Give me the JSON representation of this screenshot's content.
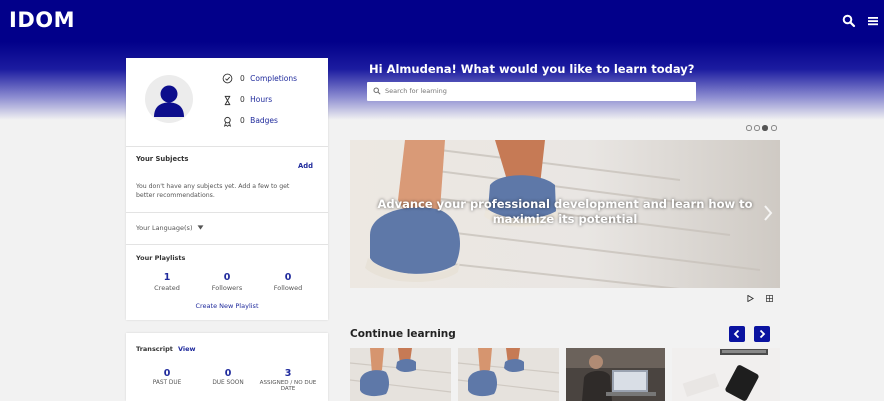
{
  "header": {
    "logo": "IDOM"
  },
  "greeting": "Hi Almudena! What would you like to learn today?",
  "search": {
    "placeholder": "Search for learning"
  },
  "profile": {
    "completions_count": "0",
    "completions_label": "Completions",
    "hours_count": "0",
    "hours_label": "Hours",
    "badges_count": "0",
    "badges_label": "Badges"
  },
  "subjects": {
    "title": "Your Subjects",
    "add_label": "Add",
    "empty_text_1": "You don't have any subjects yet. Add a few to get",
    "empty_text_2": "better recommendations."
  },
  "language": {
    "label": "Your Language(s)"
  },
  "playlists": {
    "title": "Your Playlists",
    "stats": [
      {
        "value": "1",
        "label": "Created"
      },
      {
        "value": "0",
        "label": "Followers"
      },
      {
        "value": "0",
        "label": "Followed"
      }
    ],
    "create_label": "Create New Playlist"
  },
  "transcript": {
    "title": "Transcript",
    "view_label": "View",
    "stats": [
      {
        "value": "0",
        "label": "PAST DUE"
      },
      {
        "value": "0",
        "label": "DUE SOON"
      },
      {
        "value": "3",
        "label_1": "ASSIGNED / NO DUE",
        "label_2": "DATE"
      }
    ]
  },
  "banner": {
    "line1": "Advance your professional development and learn how to",
    "line2": "maximize its potential",
    "active_dot": 2
  },
  "continue_learning": {
    "title": "Continue learning"
  },
  "colors": {
    "brand": "#02008a",
    "link": "#1f2a9c",
    "accent": "#0a13a0"
  }
}
